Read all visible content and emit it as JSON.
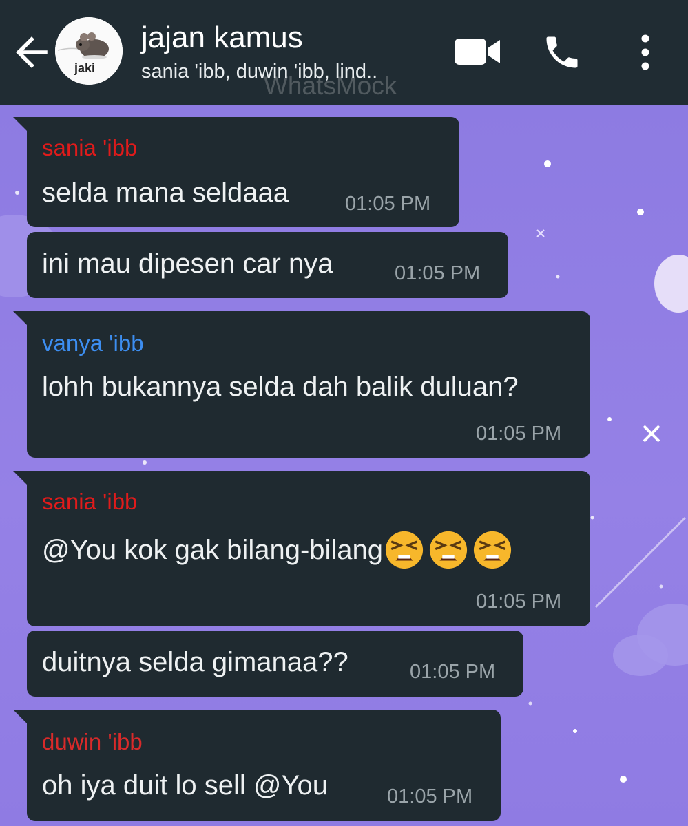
{
  "header": {
    "title": "jajan kamus",
    "subtitle": "sania 'ibb, duwin 'ibb, lind..",
    "avatar_label": "jaki",
    "watermark": "WhatsMock",
    "icons": [
      "back-arrow-icon",
      "video-call-icon",
      "phone-icon",
      "more-vertical-icon"
    ]
  },
  "colors": {
    "header_bg": "#202c33",
    "bubble_bg": "#1f2a30",
    "wallpaper": "#8f7de3",
    "sender_red": "#e01b1b",
    "sender_blue": "#3d8ef0",
    "sender_duwin": "#d92a2a"
  },
  "messages": [
    {
      "sender": "sania 'ibb",
      "text": "selda mana seldaaa",
      "time": "01:05 PM"
    },
    {
      "sender": "",
      "text": "ini mau dipesen car nya",
      "time": "01:05 PM"
    },
    {
      "sender": "vanya 'ibb",
      "text": "lohh bukannya selda dah balik duluan?",
      "time": "01:05 PM"
    },
    {
      "sender": "sania 'ibb",
      "text": "@You kok gak bilang-bilang",
      "emoji_count": 3,
      "emoji_icon": "tired-face-emoji",
      "time": "01:05 PM"
    },
    {
      "sender": "",
      "text": "duitnya selda gimanaa??",
      "time": "01:05 PM"
    },
    {
      "sender": "duwin 'ibb",
      "text": "oh iya duit lo sell @You",
      "time": "01:05 PM"
    }
  ]
}
